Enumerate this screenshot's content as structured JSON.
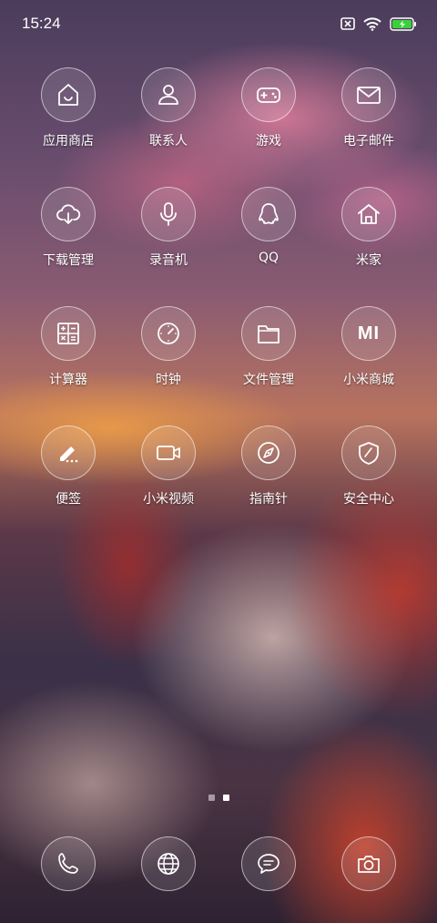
{
  "status_bar": {
    "time": "15:24",
    "icons": [
      "sim-none-icon",
      "wifi-icon",
      "battery-charging-icon"
    ],
    "battery_color": "#3ad13a"
  },
  "apps": [
    {
      "label": "应用商店",
      "icon": "store-house-icon"
    },
    {
      "label": "联系人",
      "icon": "person-icon"
    },
    {
      "label": "游戏",
      "icon": "gamepad-icon"
    },
    {
      "label": "电子邮件",
      "icon": "envelope-icon"
    },
    {
      "label": "下载管理",
      "icon": "cloud-download-icon"
    },
    {
      "label": "录音机",
      "icon": "microphone-icon"
    },
    {
      "label": "QQ",
      "icon": "qq-penguin-icon"
    },
    {
      "label": "米家",
      "icon": "home-icon"
    },
    {
      "label": "计算器",
      "icon": "calculator-icon"
    },
    {
      "label": "时钟",
      "icon": "clock-icon"
    },
    {
      "label": "文件管理",
      "icon": "folder-icon"
    },
    {
      "label": "小米商城",
      "icon": "mi-logo-icon",
      "logo_text": "MI"
    },
    {
      "label": "便签",
      "icon": "pen-note-icon"
    },
    {
      "label": "小米视频",
      "icon": "video-camera-icon"
    },
    {
      "label": "指南针",
      "icon": "compass-icon"
    },
    {
      "label": "安全中心",
      "icon": "shield-icon"
    }
  ],
  "page_indicator": {
    "pages": 2,
    "current": 2
  },
  "dock": [
    {
      "icon": "phone-icon"
    },
    {
      "icon": "browser-globe-icon"
    },
    {
      "icon": "messages-icon"
    },
    {
      "icon": "camera-icon"
    }
  ]
}
